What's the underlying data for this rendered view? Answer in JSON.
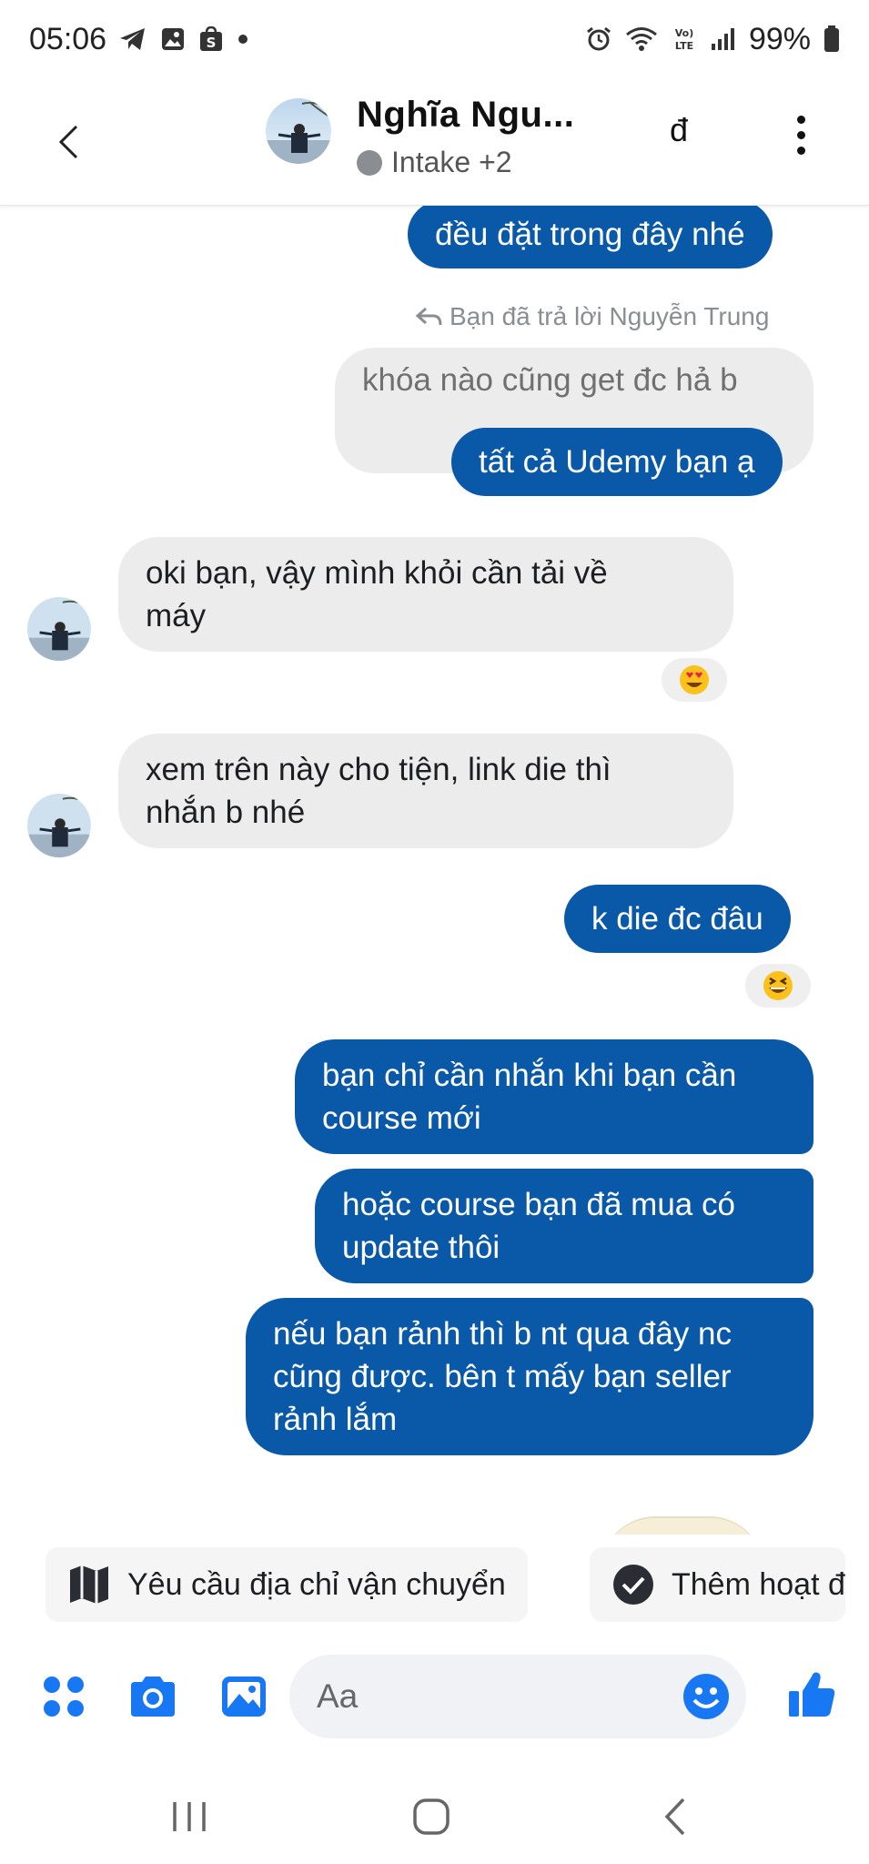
{
  "status_bar": {
    "time": "05:06",
    "battery": "99%",
    "network_label": "VoLTE"
  },
  "header": {
    "contact_name": "Nghĩa Ngu...",
    "subtitle": "Intake +2",
    "currency_symbol": "đ",
    "icons": [
      "back-arrow-icon",
      "avatar",
      "presence-dot",
      "currency-icon",
      "more-vertical-icon"
    ]
  },
  "messages": [
    {
      "id": "m1",
      "direction": "out",
      "text": "đều đặt trong đây nhé"
    },
    {
      "id": "m2",
      "reply_label": "Bạn đã trả lời Nguyễn Trung",
      "quoted_text": "khóa nào cũng get đc hả b",
      "direction": "out",
      "text": "tất cả Udemy bạn ạ"
    },
    {
      "id": "m3",
      "direction": "in",
      "text": "oki bạn, vậy mình khỏi cần tải về\nmáy",
      "reaction": "heart-eyes"
    },
    {
      "id": "m4",
      "direction": "in",
      "text": "xem trên này cho tiện, link die thì\nnhắn b nhé"
    },
    {
      "id": "m5",
      "direction": "out",
      "text": "k die đc đâu",
      "reaction": "grin-squint"
    },
    {
      "id": "m6",
      "direction": "out",
      "text": "bạn chỉ cần nhắn khi bạn cần\ncourse mới"
    },
    {
      "id": "m7",
      "direction": "out",
      "text": "hoặc course bạn đã mua có\nupdate thôi"
    },
    {
      "id": "m8",
      "direction": "out",
      "text": "nếu bạn rảnh thì b nt qua đây nc\ncũng được. bên t mấy bạn seller\nrảnh lắm"
    }
  ],
  "quick_actions": [
    {
      "label": "Yêu cầu địa chỉ vận chuyển",
      "icon": "map-icon"
    },
    {
      "label": "Thêm hoạt đ",
      "icon": "check-circle-icon"
    }
  ],
  "composer": {
    "placeholder": "Aa",
    "icons": [
      "apps-grid-icon",
      "camera-icon",
      "gallery-icon",
      "emoji-icon",
      "thumbs-up-icon"
    ]
  },
  "colors": {
    "outgoing_bubble": "#0a59a8",
    "incoming_bubble": "#ececec",
    "accent": "#1877f2"
  }
}
